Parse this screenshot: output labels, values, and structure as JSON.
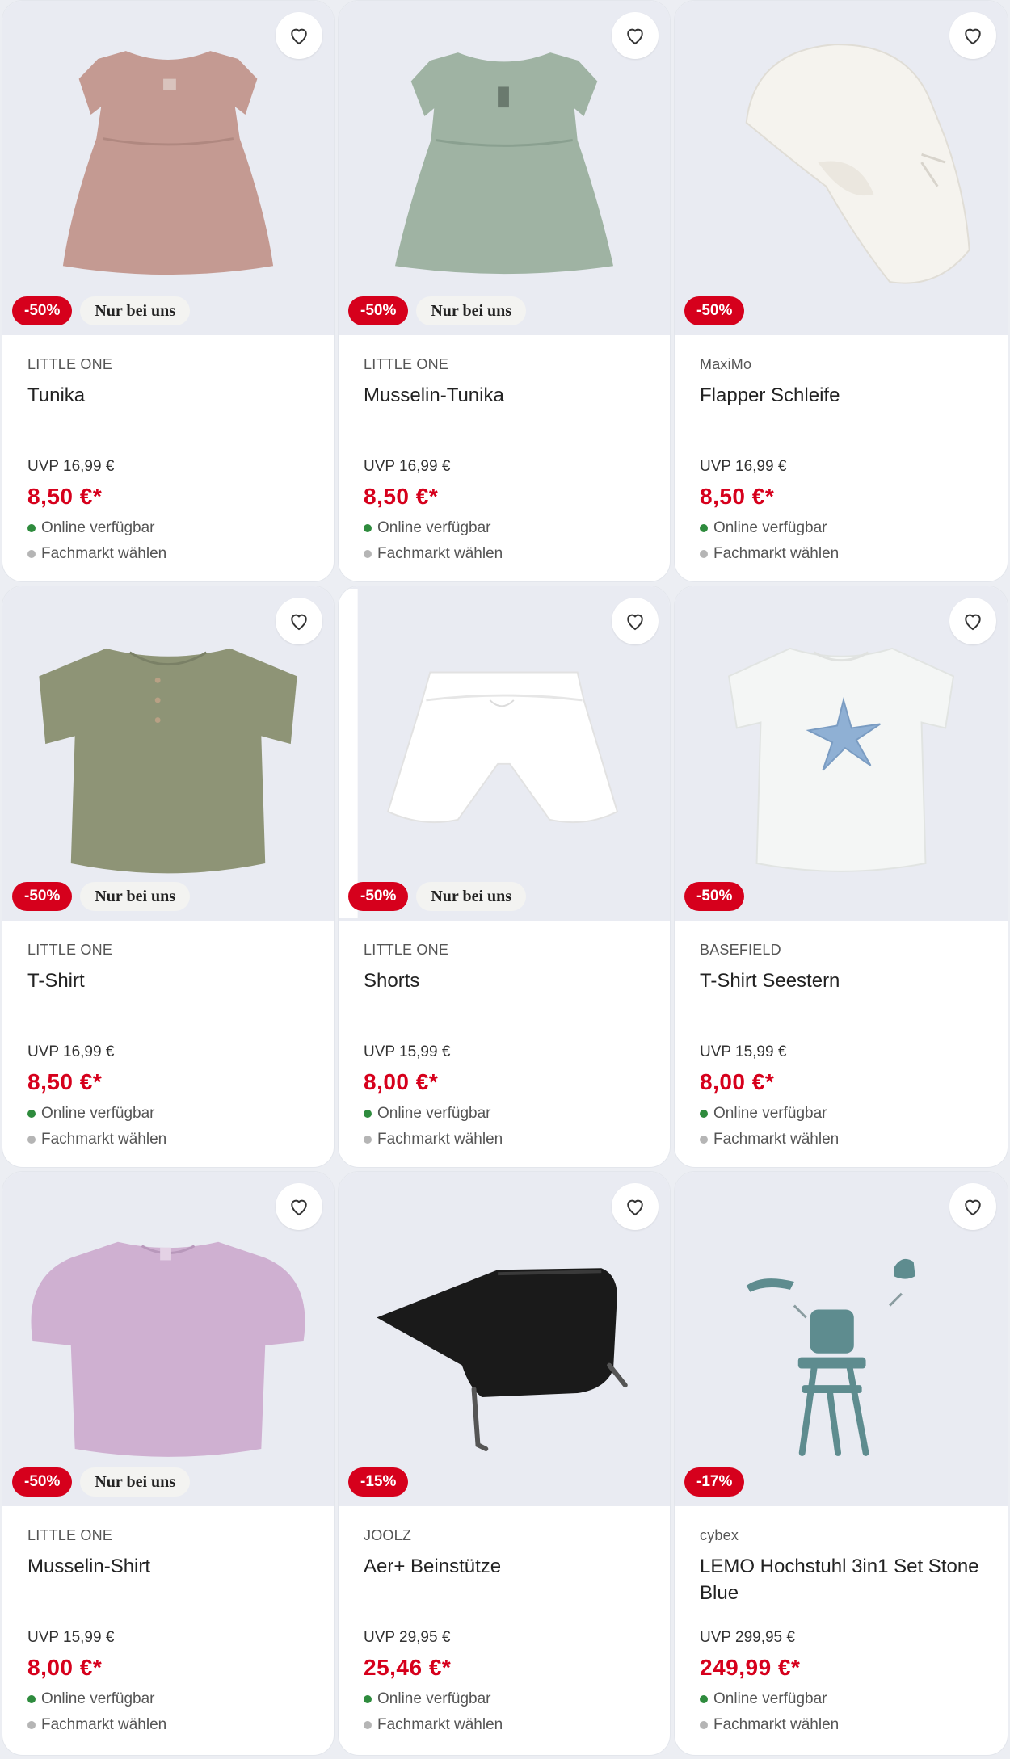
{
  "colors": {
    "sale": "#d6001c",
    "available": "#2e8b3d",
    "store": "#b5b5b5",
    "tile_bg": "#e9ebf2"
  },
  "products": [
    {
      "brand": "LITTLE ONE",
      "name": "Tunika",
      "uvp": "UVP 16,99 €",
      "price": "8,50 €*",
      "discount": "-50%",
      "exclusive": "Nur bei uns",
      "availability": "Online verfügbar",
      "store": "Fachmarkt wählen",
      "icon": "dress-image"
    },
    {
      "brand": "LITTLE ONE",
      "name": "Musselin-Tunika",
      "uvp": "UVP 16,99 €",
      "price": "8,50 €*",
      "discount": "-50%",
      "exclusive": "Nur bei uns",
      "availability": "Online verfügbar",
      "store": "Fachmarkt wählen",
      "icon": "dress-image"
    },
    {
      "brand": "MaxiMo",
      "name": "Flapper Schleife",
      "uvp": "UVP 16,99 €",
      "price": "8,50 €*",
      "discount": "-50%",
      "exclusive": "",
      "availability": "Online verfügbar",
      "store": "Fachmarkt wählen",
      "icon": "hat-image"
    },
    {
      "brand": "LITTLE ONE",
      "name": "T-Shirt",
      "uvp": "UVP 16,99 €",
      "price": "8,50 €*",
      "discount": "-50%",
      "exclusive": "Nur bei uns",
      "availability": "Online verfügbar",
      "store": "Fachmarkt wählen",
      "icon": "shirt-image"
    },
    {
      "brand": "LITTLE ONE",
      "name": "Shorts",
      "uvp": "UVP 15,99 €",
      "price": "8,00 €*",
      "discount": "-50%",
      "exclusive": "Nur bei uns",
      "availability": "Online verfügbar",
      "store": "Fachmarkt wählen",
      "icon": "shorts-image"
    },
    {
      "brand": "BASEFIELD",
      "name": "T-Shirt Seestern",
      "uvp": "UVP 15,99 €",
      "price": "8,00 €*",
      "discount": "-50%",
      "exclusive": "",
      "availability": "Online verfügbar",
      "store": "Fachmarkt wählen",
      "icon": "tshirt-starfish-image"
    },
    {
      "brand": "LITTLE ONE",
      "name": "Musselin-Shirt",
      "uvp": "UVP 15,99 €",
      "price": "8,00 €*",
      "discount": "-50%",
      "exclusive": "Nur bei uns",
      "availability": "Online verfügbar",
      "store": "Fachmarkt wählen",
      "icon": "puff-shirt-image"
    },
    {
      "brand": "JOOLZ",
      "name": "Aer+ Beinstütze",
      "uvp": "UVP 29,95 €",
      "price": "25,46 €*",
      "discount": "-15%",
      "exclusive": "",
      "availability": "Online verfügbar",
      "store": "Fachmarkt wählen",
      "icon": "leg-rest-image"
    },
    {
      "brand": "cybex",
      "name": "LEMO Hochstuhl 3in1 Set Stone Blue",
      "uvp": "UVP 299,95 €",
      "price": "249,99 €*",
      "discount": "-17%",
      "exclusive": "",
      "availability": "Online verfügbar",
      "store": "Fachmarkt wählen",
      "icon": "high-chair-image"
    }
  ]
}
